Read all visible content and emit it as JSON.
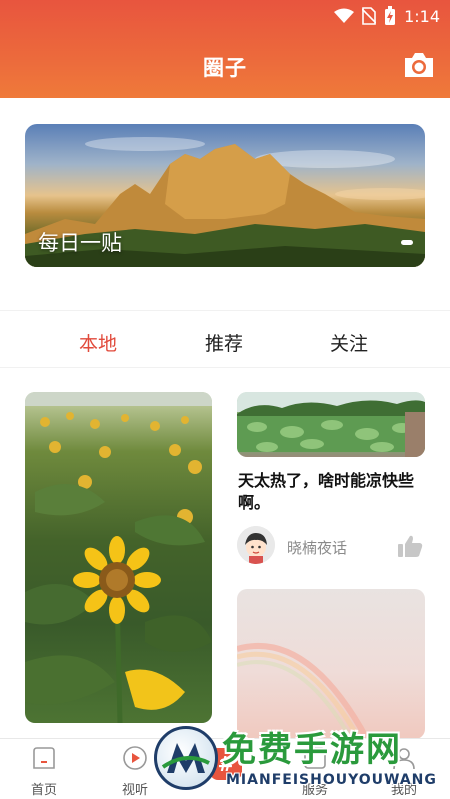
{
  "status_bar": {
    "time": "1:14"
  },
  "header": {
    "title": "圈子"
  },
  "banner": {
    "caption": "每日一贴"
  },
  "tabs": [
    {
      "label": "本地",
      "active": true
    },
    {
      "label": "推荐",
      "active": false
    },
    {
      "label": "关注",
      "active": false
    }
  ],
  "posts": {
    "right_top": {
      "title": "天太热了，啥时能凉快些啊。",
      "author": "晓楠夜话"
    }
  },
  "bottom_nav": {
    "items": [
      {
        "label": "首页"
      },
      {
        "label": "视听"
      },
      {
        "label": "#"
      },
      {
        "label": "服务"
      },
      {
        "label": "我的"
      }
    ]
  },
  "watermark": {
    "text": "免费手游网",
    "sub": "MIANFEISHOUYOUWANG"
  },
  "colors": {
    "accent": "#e8553e",
    "tab_active": "#e14a3b"
  }
}
